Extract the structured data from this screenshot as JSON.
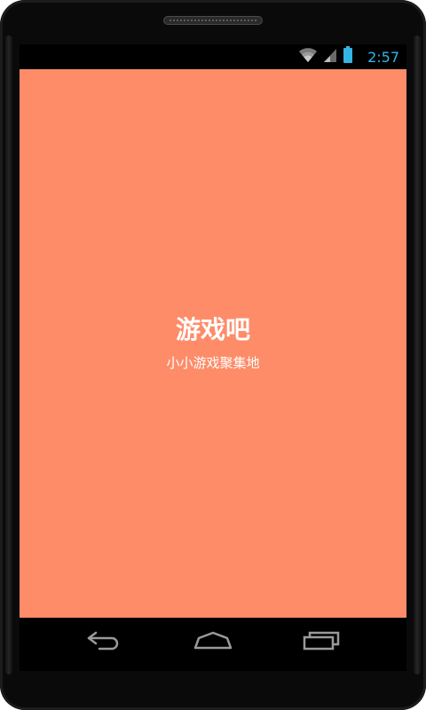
{
  "status_bar": {
    "time": "2:57",
    "icons": [
      "wifi-icon",
      "signal-icon",
      "battery-icon"
    ]
  },
  "splash": {
    "title": "游戏吧",
    "subtitle": "小小游戏聚集地",
    "background_color": "#fe8c69",
    "text_color": "#ffffff"
  },
  "nav_bar": {
    "buttons": [
      "back-icon",
      "home-icon",
      "recent-apps-icon"
    ]
  },
  "colors": {
    "status_time": "#33b5e5",
    "nav_icon": "#9a9a9a"
  }
}
